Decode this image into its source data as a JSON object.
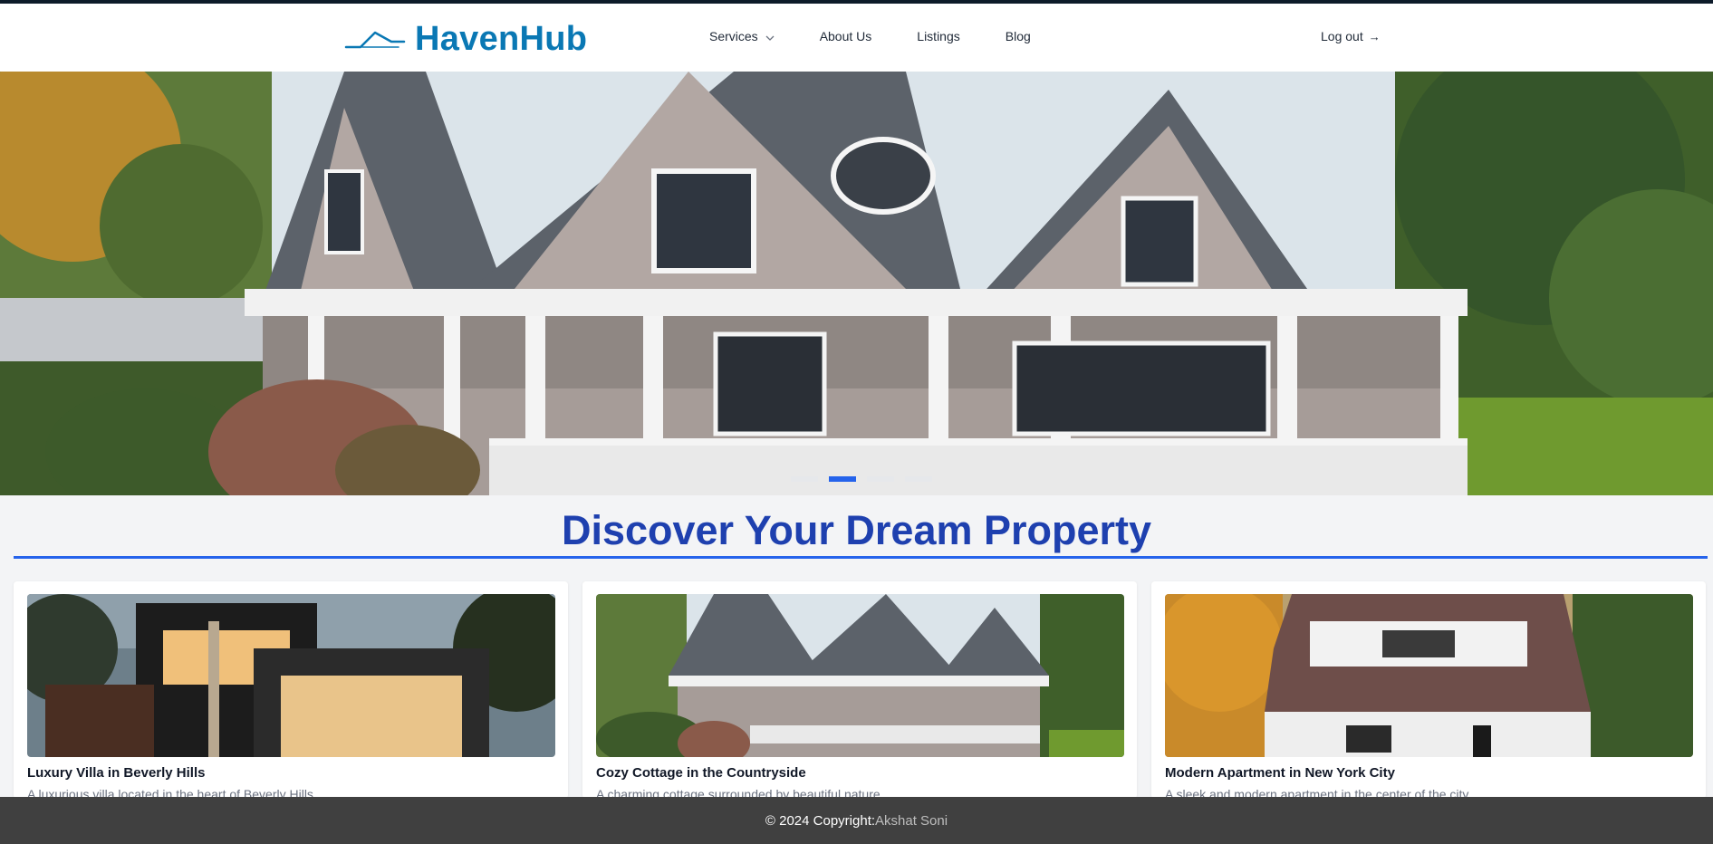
{
  "header": {
    "logo_text": "HavenHub",
    "logo_icon": "house-roof-logo-icon",
    "nav": [
      {
        "label": "Services",
        "has_dropdown": true
      },
      {
        "label": "About Us"
      },
      {
        "label": "Listings"
      },
      {
        "label": "Blog"
      }
    ],
    "logout_label": "Log out",
    "logout_icon": "→"
  },
  "hero": {
    "image": "gray-shingle-house-with-porch",
    "carousel_slides": 4,
    "active_slide": 2
  },
  "main": {
    "heading": "Discover Your Dream Property",
    "cards": [
      {
        "title": "Luxury Villa in Beverly Hills",
        "description": "A luxurious villa located in the heart of Beverly Hills.",
        "image": "modern-villa-photo"
      },
      {
        "title": "Cozy Cottage in the Countryside",
        "description": "A charming cottage surrounded by beautiful nature.",
        "image": "shingle-cottage-photo"
      },
      {
        "title": "Modern Apartment in New York City",
        "description": "A sleek and modern apartment in the center of the city.",
        "image": "white-house-autumn-photo"
      }
    ]
  },
  "footer": {
    "copyright": "© 2024 Copyright:",
    "author": "Akshat Soni"
  },
  "colors": {
    "brand": "#0a78b4",
    "heading": "#1e40af",
    "accent": "#2563eb",
    "footer_bg": "#404040"
  }
}
